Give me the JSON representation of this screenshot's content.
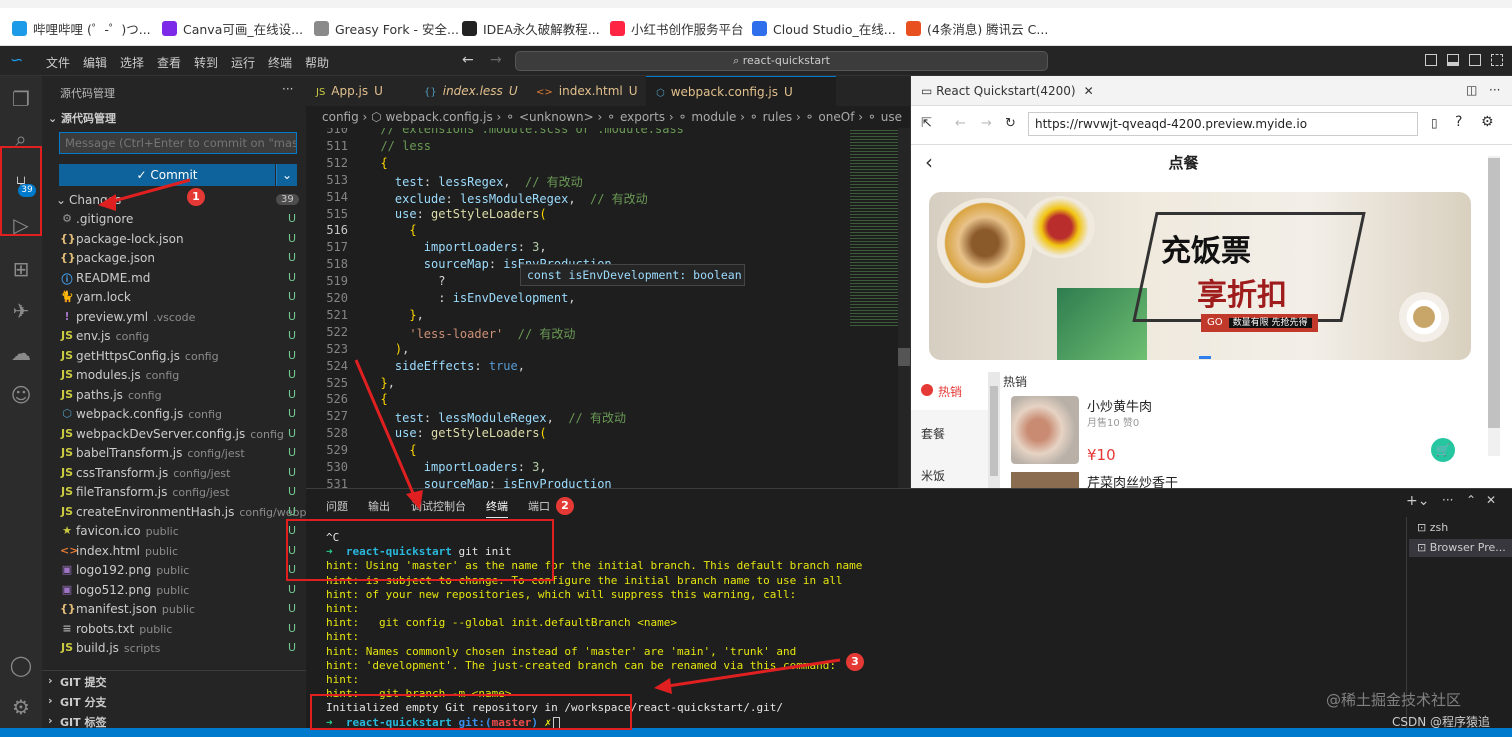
{
  "bookmarks": [
    {
      "label": "哔哩哔哩 (゜-゜)つ...",
      "color": "#1e9be8"
    },
    {
      "label": "Canva可画_在线设...",
      "color": "#7d2ae8"
    },
    {
      "label": "Greasy Fork - 安全...",
      "color": "#8a8a8a"
    },
    {
      "label": "IDEA永久破解教程...",
      "color": "#222"
    },
    {
      "label": "小红书创作服务平台",
      "color": "#ff2442"
    },
    {
      "label": "Cloud Studio_在线...",
      "color": "#2f6fec"
    },
    {
      "label": "(4条消息) 腾讯云 C...",
      "color": "#e8501f"
    }
  ],
  "menu": [
    "文件",
    "编辑",
    "选择",
    "查看",
    "转到",
    "运行",
    "终端",
    "帮助"
  ],
  "command_center": "react-quickstart",
  "scm": {
    "header": "源代码管理",
    "section": "源代码管理",
    "message_placeholder": "Message (Ctrl+Enter to commit on \"master\")",
    "commit_label": "Commit",
    "changes_label": "Changes",
    "changes_count": "39",
    "activity_badge": "39",
    "files": [
      {
        "icon": "⚙",
        "color": "#999",
        "name": ".gitignore",
        "dir": "",
        "status": "U"
      },
      {
        "icon": "{}",
        "color": "#e5c07b",
        "name": "package-lock.json",
        "dir": "",
        "status": "U"
      },
      {
        "icon": "{}",
        "color": "#e5c07b",
        "name": "package.json",
        "dir": "",
        "status": "U"
      },
      {
        "icon": "ⓘ",
        "color": "#42a5f5",
        "name": "README.md",
        "dir": "",
        "status": "U"
      },
      {
        "icon": "🐈",
        "color": "#2188b6",
        "name": "yarn.lock",
        "dir": "",
        "status": "U"
      },
      {
        "icon": "!",
        "color": "#a074c4",
        "name": "preview.yml",
        "dir": ".vscode",
        "status": "U"
      },
      {
        "icon": "JS",
        "color": "#cbcb41",
        "name": "env.js",
        "dir": "config",
        "status": "U"
      },
      {
        "icon": "JS",
        "color": "#cbcb41",
        "name": "getHttpsConfig.js",
        "dir": "config",
        "status": "U"
      },
      {
        "icon": "JS",
        "color": "#cbcb41",
        "name": "modules.js",
        "dir": "config",
        "status": "U"
      },
      {
        "icon": "JS",
        "color": "#cbcb41",
        "name": "paths.js",
        "dir": "config",
        "status": "U"
      },
      {
        "icon": "⬡",
        "color": "#519aba",
        "name": "webpack.config.js",
        "dir": "config",
        "status": "U"
      },
      {
        "icon": "JS",
        "color": "#cbcb41",
        "name": "webpackDevServer.config.js",
        "dir": "config",
        "status": "U"
      },
      {
        "icon": "JS",
        "color": "#cbcb41",
        "name": "babelTransform.js",
        "dir": "config/jest",
        "status": "U"
      },
      {
        "icon": "JS",
        "color": "#cbcb41",
        "name": "cssTransform.js",
        "dir": "config/jest",
        "status": "U"
      },
      {
        "icon": "JS",
        "color": "#cbcb41",
        "name": "fileTransform.js",
        "dir": "config/jest",
        "status": "U"
      },
      {
        "icon": "JS",
        "color": "#cbcb41",
        "name": "createEnvironmentHash.js",
        "dir": "config/webp...",
        "status": "U"
      },
      {
        "icon": "★",
        "color": "#cbcb41",
        "name": "favicon.ico",
        "dir": "public",
        "status": "U"
      },
      {
        "icon": "<>",
        "color": "#e37933",
        "name": "index.html",
        "dir": "public",
        "status": "U"
      },
      {
        "icon": "▣",
        "color": "#a074c4",
        "name": "logo192.png",
        "dir": "public",
        "status": "U"
      },
      {
        "icon": "▣",
        "color": "#a074c4",
        "name": "logo512.png",
        "dir": "public",
        "status": "U"
      },
      {
        "icon": "{}",
        "color": "#e5c07b",
        "name": "manifest.json",
        "dir": "public",
        "status": "U"
      },
      {
        "icon": "≡",
        "color": "#aaa",
        "name": "robots.txt",
        "dir": "public",
        "status": "U"
      },
      {
        "icon": "JS",
        "color": "#cbcb41",
        "name": "build.js",
        "dir": "scripts",
        "status": "U"
      }
    ],
    "git_sections": [
      "GIT 提交",
      "GIT 分支",
      "GIT 标签"
    ]
  },
  "tabs": [
    {
      "label": "App.js",
      "status": "U",
      "icon": "JS"
    },
    {
      "label": "index.less",
      "status": "U",
      "icon": "{}"
    },
    {
      "label": "index.html",
      "status": "U",
      "icon": "<>"
    },
    {
      "label": "webpack.config.js",
      "status": "U",
      "icon": "⬡"
    }
  ],
  "breadcrumbs": "config › ⬡ webpack.config.js › ⚬ <unknown> › ⚬ exports › ⚬ module › ⚬ rules › ⚬ oneOf › ⚬ use",
  "code": {
    "lines": [
      {
        "n": "510",
        "t": "  // extensions .module.scss or .module.sass"
      },
      {
        "n": "511",
        "t": "  // less"
      },
      {
        "n": "512",
        "t": "  {"
      },
      {
        "n": "513",
        "t": "    test: lessRegex,  // 有改动"
      },
      {
        "n": "514",
        "t": "    exclude: lessModuleRegex,  // 有改动"
      },
      {
        "n": "515",
        "t": "    use: getStyleLoaders("
      },
      {
        "n": "516",
        "t": "      {"
      },
      {
        "n": "517",
        "t": "        importLoaders: 3,"
      },
      {
        "n": "518",
        "t": "        sourceMap: isEnvProduction"
      },
      {
        "n": "519",
        "t": "          ?"
      },
      {
        "n": "520",
        "t": "          : isEnvDevelopment,"
      },
      {
        "n": "521",
        "t": "      },"
      },
      {
        "n": "522",
        "t": "      'less-loader'  // 有改动"
      },
      {
        "n": "523",
        "t": "    ),"
      },
      {
        "n": "524",
        "t": "    sideEffects: true,"
      },
      {
        "n": "525",
        "t": "  },"
      },
      {
        "n": "526",
        "t": "  {"
      },
      {
        "n": "527",
        "t": "    test: lessModuleRegex,  // 有改动"
      },
      {
        "n": "528",
        "t": "    use: getStyleLoaders("
      },
      {
        "n": "529",
        "t": "      {"
      },
      {
        "n": "530",
        "t": "        importLoaders: 3,"
      },
      {
        "n": "531",
        "t": "        sourceMap: isEnvProduction"
      }
    ],
    "hover": "const isEnvDevelopment: boolean"
  },
  "panel": {
    "tabs": [
      "问题",
      "输出",
      "调试控制台",
      "终端",
      "端口"
    ],
    "active_tab": "终端",
    "terminals": [
      "zsh",
      "Browser Pre..."
    ],
    "lines": [
      "^C",
      "➜  react-quickstart git init",
      "hint: Using 'master' as the name for the initial branch. This default branch name",
      "hint: is subject to change. To configure the initial branch name to use in all",
      "hint: of your new repositories, which will suppress this warning, call:",
      "hint:",
      "hint:   git config --global init.defaultBranch <name>",
      "hint:",
      "hint: Names commonly chosen instead of 'master' are 'main', 'trunk' and",
      "hint: 'development'. The just-created branch can be renamed via this command:",
      "hint:",
      "hint:   git branch -m <name>",
      "Initialized empty Git repository in /workspace/react-quickstart/.git/",
      "➜  react-quickstart git:(master) ✗"
    ]
  },
  "preview": {
    "tab_title": "React Quickstart(4200)",
    "url": "https://rwvwjt-qveaqd-4200.preview.myide.io",
    "page_title": "点餐",
    "banner_line1": "充饭票",
    "banner_line2": "享折扣",
    "banner_go": "GO",
    "banner_tag": "数量有限 先抢先得",
    "categories": [
      "热销",
      "套餐",
      "米饭"
    ],
    "section_title": "热销",
    "item1_name": "小炒黄牛肉",
    "item1_meta": "月售10 赞0",
    "item1_price": "¥10",
    "item2_name": "芹菜肉丝炒香干"
  },
  "badges": [
    "1",
    "2",
    "3"
  ],
  "watermark": "@稀土掘金技术社区",
  "watermark2": "CSDN @程序猿追"
}
